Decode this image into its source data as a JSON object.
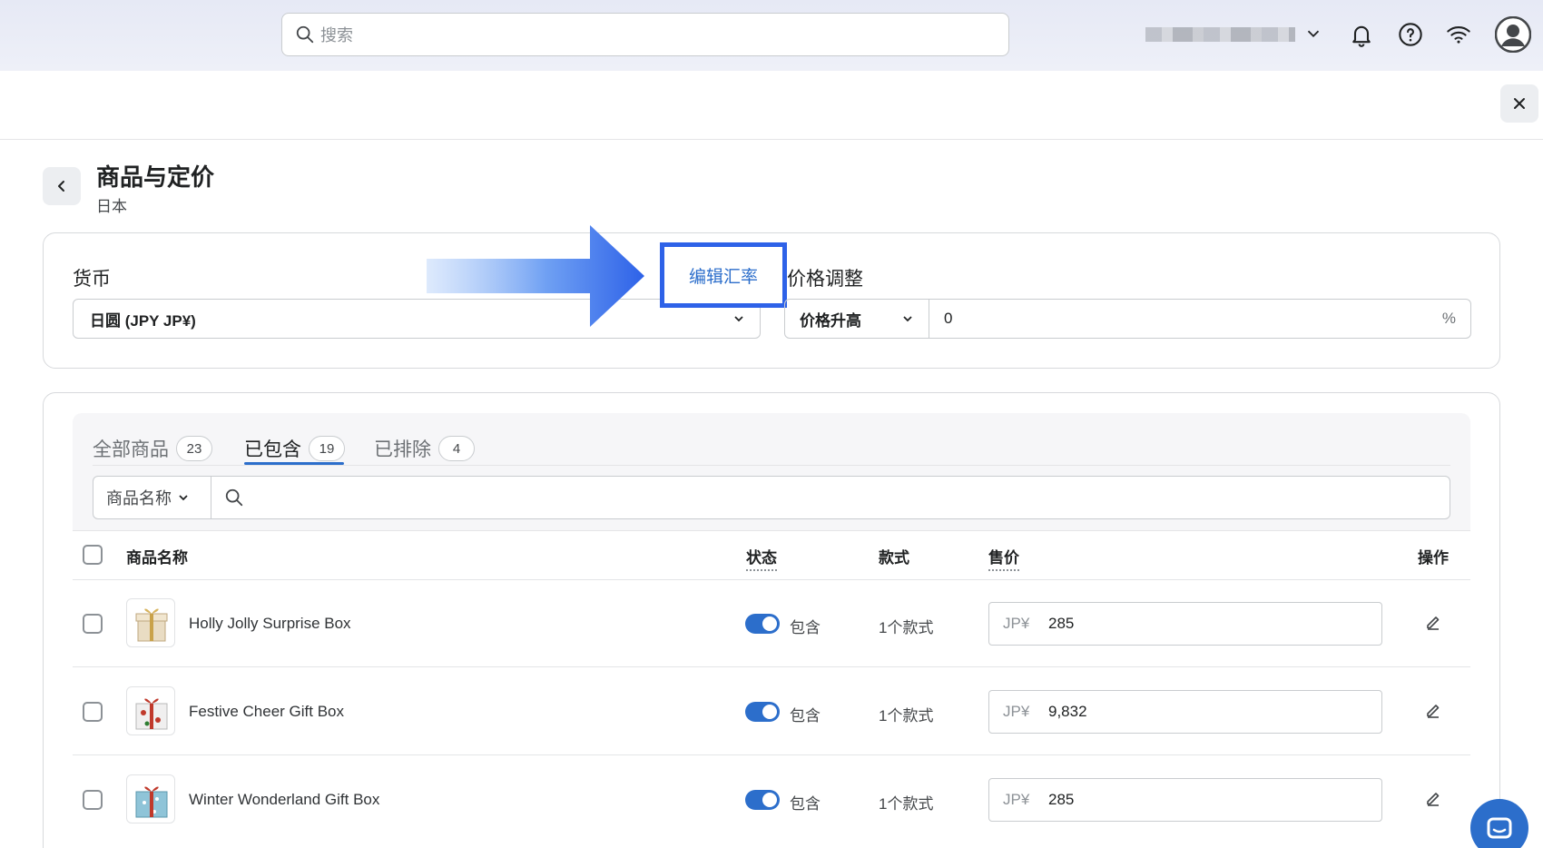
{
  "topbar": {
    "search_placeholder": "搜索",
    "icons": [
      "search-icon",
      "chevron-down-icon",
      "bell-icon",
      "help-icon",
      "wifi-icon",
      "avatar-icon"
    ]
  },
  "page": {
    "title": "商品与定价",
    "subtitle": "日本"
  },
  "currency": {
    "label": "货币",
    "value": "日圆 (JPY JP¥)",
    "edit_rate_label": "编辑汇率"
  },
  "price_adjust": {
    "label": "价格调整",
    "mode": "价格升高",
    "value": "0",
    "unit": "%"
  },
  "tabs": [
    {
      "label": "全部商品",
      "count": "23"
    },
    {
      "label": "已包含",
      "count": "19"
    },
    {
      "label": "已排除",
      "count": "4"
    }
  ],
  "filter": {
    "field": "商品名称"
  },
  "table": {
    "headers": {
      "name": "商品名称",
      "status": "状态",
      "variants": "款式",
      "price": "售价",
      "actions": "操作"
    },
    "rows": [
      {
        "name": "Holly Jolly Surprise Box",
        "status": "包含",
        "variants": "1个款式",
        "currency": "JP¥",
        "price": "285"
      },
      {
        "name": "Festive Cheer Gift Box",
        "status": "包含",
        "variants": "1个款式",
        "currency": "JP¥",
        "price": "9,832"
      },
      {
        "name": "Winter Wonderland Gift Box",
        "status": "包含",
        "variants": "1个款式",
        "currency": "JP¥",
        "price": "285"
      }
    ]
  },
  "colors": {
    "accent": "#2c6ecb",
    "highlight_border": "#2e62e8",
    "topbar_bg": "#e6e9f5"
  }
}
